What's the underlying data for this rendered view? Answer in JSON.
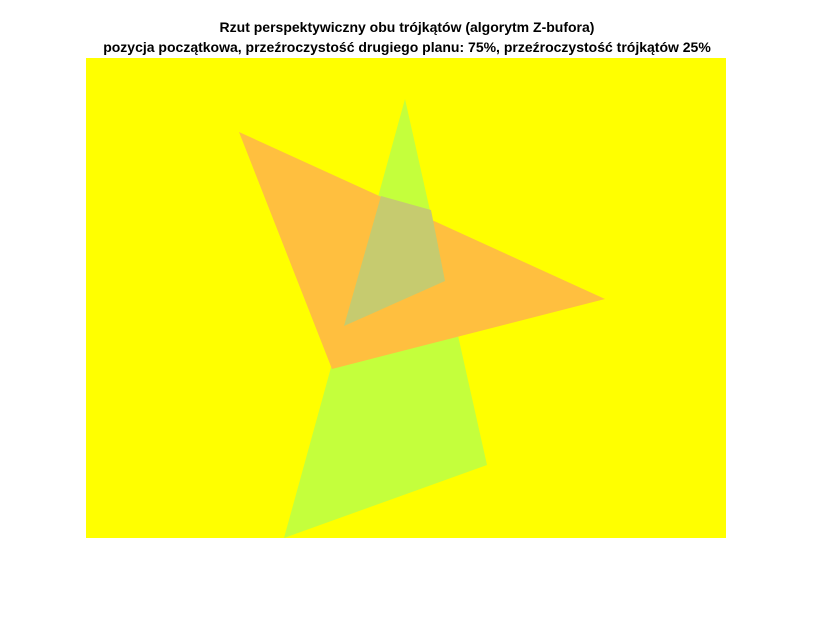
{
  "figure": {
    "title_line1": "Rzut perspektywiczny obu trójkątów (algorytm Z-bufora)",
    "title_line2": "pozycja początkowa, przeźroczystość drugiego planu: 75%, przeźroczystość trójkątów 25%"
  },
  "scene": {
    "background_color": "#ffff00",
    "background_transparency_percent": 75,
    "triangle_transparency_percent": 25,
    "triangles": [
      {
        "name": "green-triangle",
        "color": "#c4ff3c"
      },
      {
        "name": "orange-triangle",
        "color": "#ffbf3f"
      }
    ]
  }
}
